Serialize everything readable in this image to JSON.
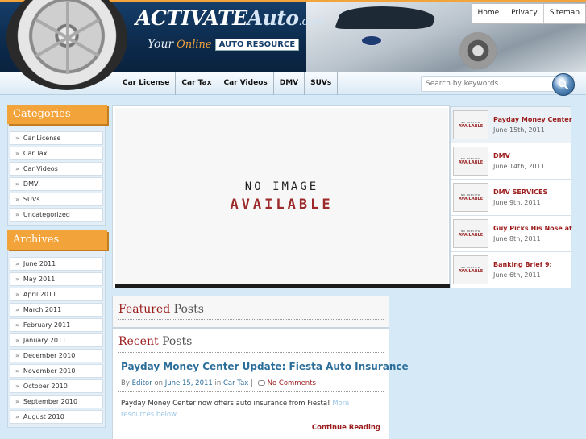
{
  "header": {
    "title_main": "ACTIVATE",
    "title_auto": "Auto",
    "title_dotcom": ".com",
    "tagline_your": "Your",
    "tagline_online": "Online",
    "tagline_box": "AUTO RESOURCE"
  },
  "toplinks": [
    "Home",
    "Privacy",
    "Sitemap"
  ],
  "nav": [
    "Car License",
    "Car Tax",
    "Car Videos",
    "DMV",
    "SUVs"
  ],
  "search": {
    "placeholder": "Search by keywords"
  },
  "sidebar": {
    "categories_title": "Categories",
    "categories": [
      "Car License",
      "Car Tax",
      "Car Videos",
      "DMV",
      "SUVs",
      "Uncategorized"
    ],
    "archives_title": "Archives",
    "archives": [
      "June 2011",
      "May 2011",
      "April 2011",
      "March 2011",
      "February 2011",
      "January 2011",
      "December 2010",
      "November 2010",
      "October 2010",
      "September 2010",
      "August 2010"
    ]
  },
  "slider": {
    "line1": "NO IMAGE",
    "line2": "AVAILABLE"
  },
  "thumb_image": {
    "line1": "NO PREVIEW",
    "line2": "AVAILABLE"
  },
  "thumbs": [
    {
      "title": "Payday Money Center",
      "date": "June 15th, 2011"
    },
    {
      "title": "DMV",
      "date": "June 14th, 2011"
    },
    {
      "title": "DMV SERVICES",
      "date": "June 9th, 2011"
    },
    {
      "title": "Guy Picks His Nose at",
      "date": "June 8th, 2011"
    },
    {
      "title": "Banking Brief 9:",
      "date": "June 6th, 2011"
    }
  ],
  "featured": {
    "a": "Featured",
    "b": "Posts"
  },
  "recent": {
    "a": "Recent",
    "b": "Posts"
  },
  "post": {
    "title": "Payday Money Center Update: Fiesta Auto Insurance",
    "by": "By",
    "author": "Editor",
    "on": "on",
    "date": "June 15, 2011",
    "in": "in",
    "category": "Car Tax",
    "sep": "|",
    "comments": "No Comments",
    "excerpt": "Payday Money Center now offers auto insurance from Fiesta!",
    "more": "More resources below",
    "continue": "Continue Reading"
  },
  "colors": {
    "accent": "#f2a33a",
    "link": "#2b6e9a",
    "title_red": "#9c1c1c",
    "bg": "#d6e9f7"
  }
}
